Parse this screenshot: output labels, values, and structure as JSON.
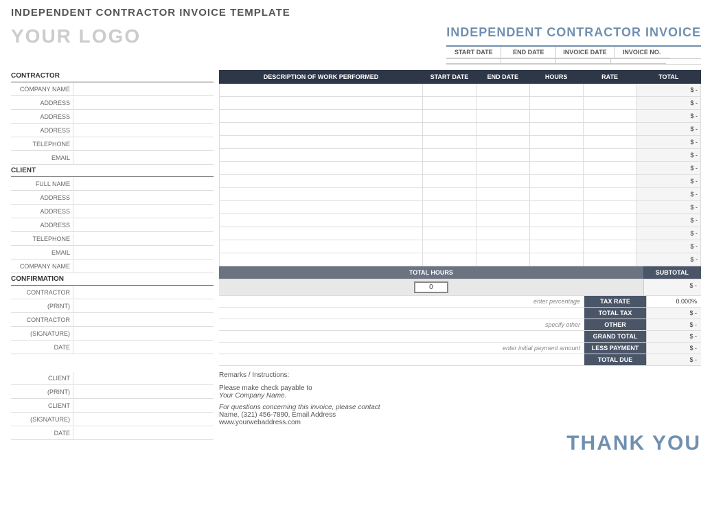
{
  "page": {
    "title": "INDEPENDENT CONTRACTOR INVOICE TEMPLATE"
  },
  "header": {
    "logo": "YOUR LOGO",
    "invoice_title": "INDEPENDENT CONTRACTOR INVOICE",
    "date_labels": [
      "START DATE",
      "END DATE",
      "INVOICE DATE",
      "INVOICE NO."
    ],
    "date_values": [
      "",
      "",
      "",
      ""
    ]
  },
  "contractor_section": {
    "heading": "CONTRACTOR",
    "fields": [
      {
        "label": "COMPANY NAME",
        "value": ""
      },
      {
        "label": "ADDRESS",
        "value": ""
      },
      {
        "label": "ADDRESS",
        "value": ""
      },
      {
        "label": "ADDRESS",
        "value": ""
      },
      {
        "label": "TELEPHONE",
        "value": ""
      },
      {
        "label": "EMAIL",
        "value": ""
      }
    ]
  },
  "client_section": {
    "heading": "CLIENT",
    "fields": [
      {
        "label": "FULL NAME",
        "value": ""
      },
      {
        "label": "ADDRESS",
        "value": ""
      },
      {
        "label": "ADDRESS",
        "value": ""
      },
      {
        "label": "ADDRESS",
        "value": ""
      },
      {
        "label": "TELEPHONE",
        "value": ""
      },
      {
        "label": "EMAIL",
        "value": ""
      },
      {
        "label": "COMPANY NAME",
        "value": ""
      }
    ]
  },
  "invoice_table": {
    "columns": [
      "DESCRIPTION OF WORK PERFORMED",
      "START DATE",
      "END DATE",
      "HOURS",
      "RATE",
      "TOTAL"
    ],
    "rows": [
      {
        "desc": "",
        "start": "",
        "end": "",
        "hours": "",
        "rate": "",
        "total": "$ -"
      },
      {
        "desc": "",
        "start": "",
        "end": "",
        "hours": "",
        "rate": "",
        "total": "$ -"
      },
      {
        "desc": "",
        "start": "",
        "end": "",
        "hours": "",
        "rate": "",
        "total": "$ -"
      },
      {
        "desc": "",
        "start": "",
        "end": "",
        "hours": "",
        "rate": "",
        "total": "$ -"
      },
      {
        "desc": "",
        "start": "",
        "end": "",
        "hours": "",
        "rate": "",
        "total": "$ -"
      },
      {
        "desc": "",
        "start": "",
        "end": "",
        "hours": "",
        "rate": "",
        "total": "$ -"
      },
      {
        "desc": "",
        "start": "",
        "end": "",
        "hours": "",
        "rate": "",
        "total": "$ -"
      },
      {
        "desc": "",
        "start": "",
        "end": "",
        "hours": "",
        "rate": "",
        "total": "$ -"
      },
      {
        "desc": "",
        "start": "",
        "end": "",
        "hours": "",
        "rate": "",
        "total": "$ -"
      },
      {
        "desc": "",
        "start": "",
        "end": "",
        "hours": "",
        "rate": "",
        "total": "$ -"
      },
      {
        "desc": "",
        "start": "",
        "end": "",
        "hours": "",
        "rate": "",
        "total": "$ -"
      },
      {
        "desc": "",
        "start": "",
        "end": "",
        "hours": "",
        "rate": "",
        "total": "$ -"
      },
      {
        "desc": "",
        "start": "",
        "end": "",
        "hours": "",
        "rate": "",
        "total": "$ -"
      },
      {
        "desc": "",
        "start": "",
        "end": "",
        "hours": "",
        "rate": "",
        "total": "$ -"
      }
    ],
    "total_hours_label": "TOTAL HOURS",
    "total_hours_value": "0",
    "subtotal_label": "SUBTOTAL",
    "subtotal_value": "$ -",
    "tax_rate_label": "TAX RATE",
    "tax_rate_value": "0.000%",
    "tax_rate_hint": "enter percentage",
    "total_tax_label": "TOTAL TAX",
    "total_tax_value": "$ -",
    "other_label": "OTHER",
    "other_value": "$ -",
    "other_hint": "specify other",
    "grand_total_label": "GRAND TOTAL",
    "grand_total_value": "$ -",
    "less_payment_label": "LESS PAYMENT",
    "less_payment_value": "$ -",
    "less_payment_hint": "enter initial payment amount",
    "total_due_label": "TOTAL DUE",
    "total_due_value": "$ -"
  },
  "confirmation_section": {
    "heading": "CONFIRMATION",
    "contractor_fields": [
      {
        "label": "CONTRACTOR",
        "value": ""
      },
      {
        "label": "(PRINT)",
        "value": ""
      },
      {
        "label": "CONTRACTOR",
        "value": ""
      },
      {
        "label": "(SIGNATURE)",
        "value": ""
      },
      {
        "label": "DATE",
        "value": ""
      }
    ]
  },
  "client_confirmation": {
    "fields": [
      {
        "label": "CLIENT",
        "value": ""
      },
      {
        "label": "(PRINT)",
        "value": ""
      },
      {
        "label": "CLIENT",
        "value": ""
      },
      {
        "label": "(SIGNATURE)",
        "value": ""
      },
      {
        "label": "DATE",
        "value": ""
      }
    ]
  },
  "remarks": {
    "label": "Remarks / Instructions:",
    "value": ""
  },
  "payment_info": {
    "line1": "Please make check payable to",
    "line2": "Your Company Name.",
    "line3": "For questions concerning this invoice, please contact",
    "line4": "Name, (321) 456-7890, Email Address",
    "line5": "www.yourwebaddress.com"
  },
  "thank_you": "THANK YOU"
}
